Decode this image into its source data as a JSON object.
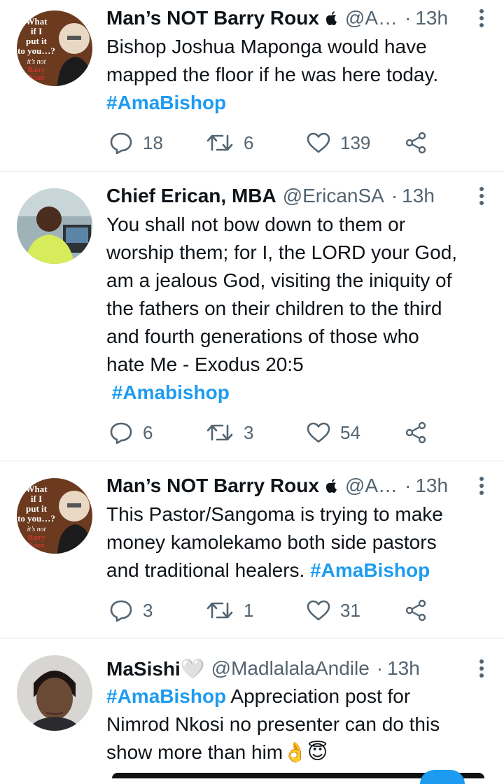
{
  "tweets": [
    {
      "name": "Man’s NOT Barry Roux",
      "handle": "@A…",
      "dot": "·",
      "time": "13h",
      "lines": [
        [
          {
            "t": "Bishop Joshua Maponga would have"
          }
        ],
        [
          {
            "t": "mapped the floor if he was here today."
          }
        ],
        [
          {
            "t": "#AmaBishop",
            "tag": true
          }
        ]
      ],
      "replies": "18",
      "retweets": "6",
      "likes": "139",
      "avatar_text": [
        "What",
        "if I",
        "put it",
        "to you…?",
        "it’s not",
        "Barry",
        "Roux"
      ]
    },
    {
      "name": "Chief Erican, MBA",
      "handle": "@EricanSA",
      "dot": "·",
      "time": "13h",
      "lines": [
        [
          {
            "t": "You shall not bow down to them or"
          }
        ],
        [
          {
            "t": "worship them; for I, the LORD your God,"
          }
        ],
        [
          {
            "t": "am a jealous God, visiting the iniquity of"
          }
        ],
        [
          {
            "t": "the fathers on their children to the third"
          }
        ],
        [
          {
            "t": "and fourth generations of those who"
          }
        ],
        [
          {
            "t": "hate Me - Exodus 20:5"
          }
        ],
        [
          {
            "t": " #Amabishop",
            "tag": true
          }
        ]
      ],
      "replies": "6",
      "retweets": "3",
      "likes": "54"
    },
    {
      "name": "Man’s NOT Barry Roux",
      "handle": "@A…",
      "dot": "·",
      "time": "13h",
      "lines": [
        [
          {
            "t": "This Pastor/Sangoma is trying to make"
          }
        ],
        [
          {
            "t": "money kamolekamo both side pastors"
          }
        ],
        [
          {
            "t": "and traditional healers. "
          },
          {
            "t": "#AmaBishop",
            "tag": true
          }
        ]
      ],
      "replies": "3",
      "retweets": "1",
      "likes": "31",
      "avatar_text": [
        "What",
        "if I",
        "put it",
        "to you…?",
        "it’s not",
        "Barry",
        "Roux"
      ]
    },
    {
      "name": "MaSishi🤍",
      "handle": "@MadlalalaAndile",
      "dot": "·",
      "time": "13h",
      "lines": [
        [
          {
            "t": "#AmaBishop",
            "tag": true
          },
          {
            "t": " Appreciation post for"
          }
        ],
        [
          {
            "t": "Nimrod Nkosi no presenter can do this"
          }
        ],
        [
          {
            "t": "show more than him👌😇"
          }
        ]
      ]
    }
  ],
  "colors": {
    "link": "#1d9bf0",
    "secondary": "#536471",
    "divider": "#dfe3e7"
  },
  "icons": [
    "apple-icon",
    "more-vertical-icon",
    "reply-icon",
    "retweet-icon",
    "like-icon",
    "share-icon"
  ]
}
